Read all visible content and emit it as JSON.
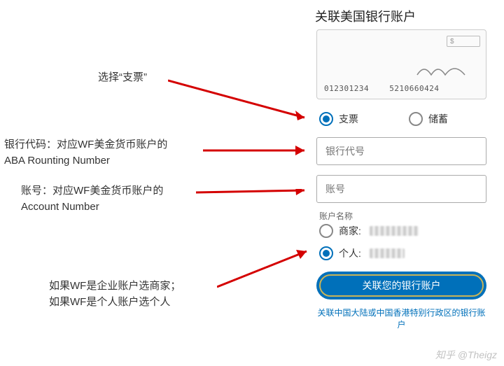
{
  "title": "关联美国银行账户",
  "check": {
    "routing": "012301234",
    "account": "5210660424",
    "amount_prefix": "$"
  },
  "accountType": {
    "checking": "支票",
    "savings": "储蓄"
  },
  "inputs": {
    "bankcode_placeholder": "银行代号",
    "account_placeholder": "账号"
  },
  "nameSection": {
    "label": "账户名称",
    "merchant": "商家:",
    "personal": "个人:"
  },
  "submit_label": "关联您的银行账户",
  "alt_link": "关联中国大陆或中国香港特别行政区的银行账户",
  "annotations": {
    "a1": "选择“支票”",
    "a2_l1": "银行代码：对应WF美金货币账户的",
    "a2_l2": "ABA Rounting Number",
    "a3_l1": "账号：对应WF美金货币账户的",
    "a3_l2": "Account Number",
    "a4_l1": "如果WF是企业账户选商家；",
    "a4_l2": "如果WF是个人账户选个人"
  },
  "watermark": "知乎 @Theigz"
}
